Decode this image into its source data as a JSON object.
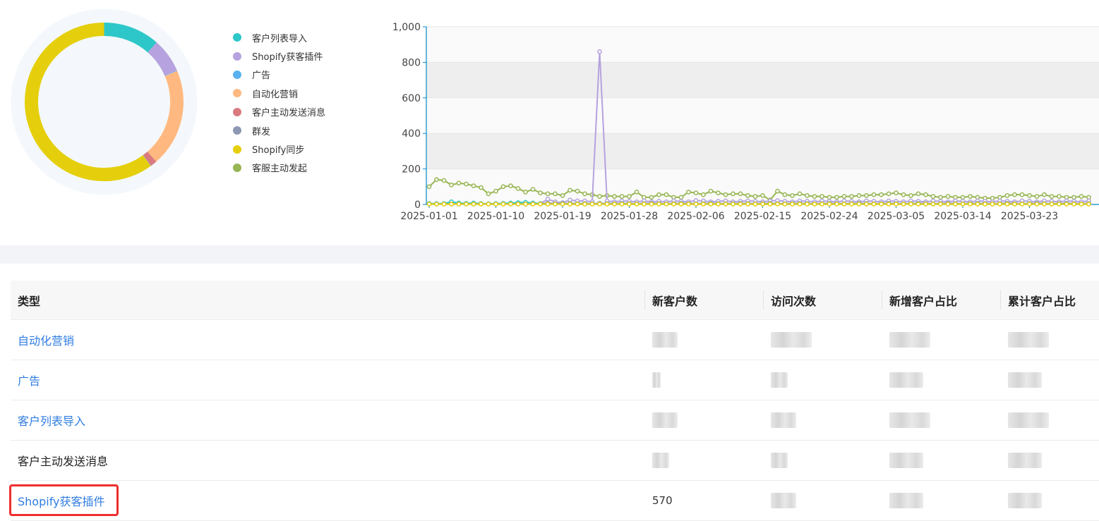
{
  "donut": {
    "segments": [
      {
        "key": "import",
        "value": 11.5,
        "color": "#2ec7c9"
      },
      {
        "key": "shopify_plugin",
        "value": 7.0,
        "color": "#b6a2de"
      },
      {
        "key": "ads",
        "value": 0.1,
        "color": "#5ab1ef"
      },
      {
        "key": "automation",
        "value": 20.0,
        "color": "#ffb980"
      },
      {
        "key": "customer_msg",
        "value": 1.3,
        "color": "#d87a80"
      },
      {
        "key": "mass",
        "value": 0.1,
        "color": "#8d98b3"
      },
      {
        "key": "shopify_sync",
        "value": 60.0,
        "color": "#e5cf0d"
      },
      {
        "key": "agent_init",
        "value": 0.0,
        "color": "#97b552"
      }
    ]
  },
  "legend": [
    {
      "label": "客户列表导入",
      "color": "#2ec7c9"
    },
    {
      "label": "Shopify获客插件",
      "color": "#b6a2de"
    },
    {
      "label": "广告",
      "color": "#5ab1ef"
    },
    {
      "label": "自动化营销",
      "color": "#ffb980"
    },
    {
      "label": "客户主动发送消息",
      "color": "#d87a80"
    },
    {
      "label": "群发",
      "color": "#8d98b3"
    },
    {
      "label": "Shopify同步",
      "color": "#e5cf0d"
    },
    {
      "label": "客服主动发起",
      "color": "#97b552"
    }
  ],
  "chart_data": {
    "type": "line",
    "ylim": [
      0,
      1000
    ],
    "yticks": [
      "0",
      "200",
      "400",
      "600",
      "800",
      "1,000"
    ],
    "xticks": [
      "2025-01-01",
      "2025-01-10",
      "2025-01-19",
      "2025-01-28",
      "2025-02-06",
      "2025-02-15",
      "2025-02-24",
      "2025-03-05",
      "2025-03-14",
      "2025-03-23"
    ],
    "series": [
      {
        "color": "#97b552",
        "values": [
          100,
          140,
          135,
          110,
          120,
          115,
          105,
          95,
          60,
          75,
          100,
          105,
          90,
          70,
          85,
          65,
          60,
          60,
          50,
          80,
          75,
          60,
          55,
          45,
          50,
          45,
          45,
          45,
          70,
          40,
          40,
          55,
          55,
          40,
          40,
          70,
          65,
          55,
          75,
          65,
          55,
          60,
          60,
          50,
          45,
          50,
          25,
          75,
          55,
          50,
          60,
          50,
          45,
          45,
          40,
          40,
          45,
          45,
          50,
          50,
          55,
          55,
          60,
          65,
          55,
          50,
          60,
          55,
          45,
          40,
          45,
          40,
          40,
          45,
          40,
          35,
          35,
          40,
          50,
          55,
          55,
          50,
          45,
          55,
          45,
          45,
          40,
          40,
          45,
          40
        ]
      },
      {
        "color": "#b6a2de",
        "values": [
          2,
          2,
          3,
          2,
          2,
          3,
          2,
          2,
          2,
          2,
          3,
          2,
          2,
          3,
          3,
          5,
          30,
          15,
          10,
          25,
          20,
          20,
          15,
          860,
          20,
          15,
          20,
          18,
          15,
          20,
          15,
          18,
          15,
          20,
          18,
          15,
          22,
          20,
          15,
          18,
          20,
          15,
          18,
          20,
          18,
          15,
          20,
          22,
          18,
          15,
          20,
          18,
          15,
          20,
          18,
          15,
          20,
          18,
          15,
          20,
          18,
          15,
          20,
          18,
          15,
          20,
          18,
          15,
          20,
          18,
          15,
          20,
          18,
          15,
          20,
          18,
          15,
          20,
          18,
          15,
          20,
          18,
          15,
          20,
          18,
          15,
          20,
          18,
          15,
          20
        ]
      },
      {
        "color": "#2ec7c9",
        "values": [
          5,
          5,
          5,
          15,
          8,
          6,
          8,
          5,
          4,
          5,
          6,
          8,
          10,
          12,
          8,
          5,
          6,
          5,
          5,
          6,
          5,
          5,
          4,
          6,
          5,
          5,
          6,
          5,
          4,
          5,
          6,
          5,
          4,
          5,
          6,
          5,
          4,
          5,
          6,
          5,
          4,
          5,
          6,
          5,
          4,
          5,
          6,
          5,
          4,
          5,
          6,
          5,
          4,
          5,
          6,
          5,
          4,
          5,
          6,
          5,
          4,
          5,
          6,
          5,
          4,
          5,
          6,
          5,
          4,
          5,
          6,
          5,
          4,
          5,
          6,
          5,
          4,
          5,
          6,
          5,
          4,
          5,
          6,
          5,
          4,
          5,
          6,
          5,
          4,
          5
        ]
      },
      {
        "color": "#8d98b3",
        "values": [
          3,
          3,
          3,
          3,
          3,
          3,
          3,
          3,
          3,
          3,
          3,
          3,
          3,
          3,
          3,
          3,
          8,
          5,
          4,
          6,
          5,
          5,
          4,
          6,
          5,
          5,
          6,
          5,
          4,
          5,
          6,
          5,
          4,
          5,
          6,
          5,
          4,
          5,
          6,
          5,
          4,
          5,
          6,
          5,
          4,
          5,
          6,
          5,
          4,
          5,
          6,
          5,
          4,
          5,
          6,
          5,
          4,
          5,
          6,
          5,
          4,
          5,
          6,
          5,
          4,
          5,
          6,
          5,
          4,
          5,
          6,
          5,
          4,
          5,
          6,
          5,
          4,
          5,
          6,
          5,
          4,
          5,
          6,
          5,
          4,
          5,
          6,
          5,
          4,
          5
        ]
      },
      {
        "color": "#e5cf0d",
        "values": [
          2,
          2,
          2,
          2,
          2,
          2,
          2,
          2,
          2,
          2,
          2,
          2,
          2,
          2,
          2,
          2,
          2,
          2,
          2,
          2,
          2,
          2,
          2,
          2,
          2,
          2,
          2,
          2,
          2,
          2,
          2,
          2,
          2,
          2,
          2,
          2,
          2,
          2,
          2,
          2,
          2,
          2,
          2,
          2,
          2,
          2,
          2,
          2,
          2,
          2,
          2,
          2,
          2,
          2,
          2,
          2,
          2,
          2,
          2,
          2,
          2,
          2,
          2,
          2,
          2,
          2,
          2,
          2,
          2,
          2,
          2,
          2,
          2,
          2,
          2,
          2,
          2,
          2,
          2,
          2,
          2,
          2,
          2,
          2,
          2,
          2,
          2,
          2,
          2,
          2
        ]
      }
    ]
  },
  "table": {
    "headers": {
      "type": "类型",
      "new_customers": "新客户数",
      "visits": "访问次数",
      "new_ratio": "新增客户占比",
      "cum_ratio": "累计客户占比"
    },
    "rows": [
      {
        "type": "自动化营销",
        "link": true,
        "new_customers": null
      },
      {
        "type": "广告",
        "link": true,
        "new_customers": null
      },
      {
        "type": "客户列表导入",
        "link": true,
        "new_customers": null
      },
      {
        "type": "客户主动发送消息",
        "link": false,
        "new_customers": null
      },
      {
        "type": "Shopify获客插件",
        "link": true,
        "new_customers": "570"
      }
    ]
  }
}
